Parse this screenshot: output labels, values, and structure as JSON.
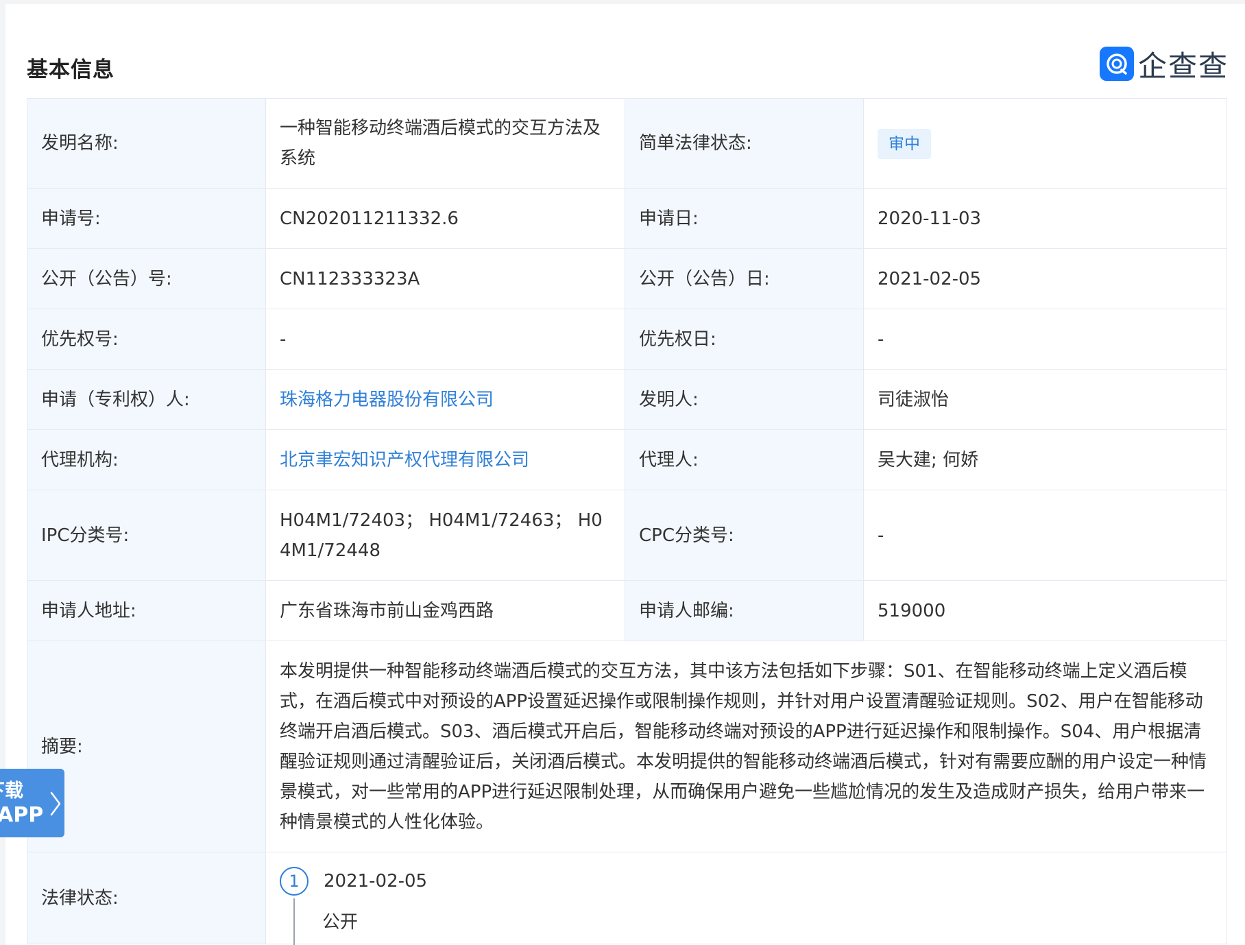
{
  "section": {
    "title": "基本信息"
  },
  "brand": {
    "name": "企查查",
    "icon": "qcc-logo-icon",
    "color": "#1677ff"
  },
  "rows": [
    {
      "l1": "发明名称:",
      "v1": "一种智能移动终端酒后模式的交互方法及系统",
      "l2": "简单法律状态:",
      "v2": "审中"
    },
    {
      "l1": "申请号:",
      "v1": "CN202011211332.6",
      "l2": "申请日:",
      "v2": "2020-11-03"
    },
    {
      "l1": "公开（公告）号:",
      "v1": "CN112333323A",
      "l2": "公开（公告）日:",
      "v2": "2021-02-05"
    },
    {
      "l1": "优先权号:",
      "v1": "-",
      "l2": "优先权日:",
      "v2": "-"
    },
    {
      "l1": "申请（专利权）人:",
      "v1": "珠海格力电器股份有限公司",
      "l2": "发明人:",
      "v2": "司徒淑怡"
    },
    {
      "l1": "代理机构:",
      "v1": "北京聿宏知识产权代理有限公司",
      "l2": "代理人:",
      "v2": "吴大建; 何娇"
    },
    {
      "l1": "IPC分类号:",
      "v1": "H04M1/72403； H04M1/72463； H04M1/72448",
      "l2": "CPC分类号:",
      "v2": "-"
    },
    {
      "l1": "申请人地址:",
      "v1": "广东省珠海市前山金鸡西路",
      "l2": "申请人邮编:",
      "v2": "519000"
    }
  ],
  "abstract": {
    "label": "摘要:",
    "text": "本发明提供一种智能移动终端酒后模式的交互方法，其中该方法包括如下步骤：S01、在智能移动终端上定义酒后模式，在酒后模式中对预设的APP设置延迟操作或限制操作规则，并针对用户设置清醒验证规则。S02、用户在智能移动终端开启酒后模式。S03、酒后模式开启后，智能移动终端对预设的APP进行延迟操作和限制操作。S04、用户根据清醒验证规则通过清醒验证后，关闭酒后模式。本发明提供的智能移动终端酒后模式，针对有需要应酬的用户设定一种情景模式，对一些常用的APP进行延迟限制处理，从而确保用户避免一些尴尬情况的发生及造成财产损失，给用户带来一种情景模式的人性化体验。"
  },
  "legal": {
    "label": "法律状态:",
    "events": [
      {
        "index": "1",
        "date": "2021-02-05",
        "status": "公开"
      }
    ]
  },
  "floating": {
    "line1": "下载",
    "line2": "APP",
    "icon": "chevron-right-icon"
  },
  "colors": {
    "link": "#2f7fd8",
    "label_bg": "#f2f8fd",
    "border": "#e5eaf2"
  }
}
